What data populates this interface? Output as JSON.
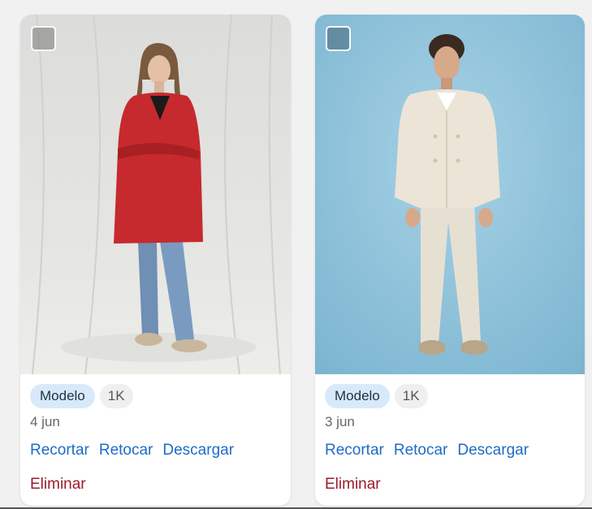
{
  "cards": [
    {
      "tag": "Modelo",
      "resolution": "1K",
      "date": "4 jun",
      "actions": {
        "crop": "Recortar",
        "retouch": "Retocar",
        "download": "Descargar"
      },
      "delete": "Eliminar",
      "image": {
        "subject": "woman-red-coat",
        "background": "#e2e2e0"
      }
    },
    {
      "tag": "Modelo",
      "resolution": "1K",
      "date": "3 jun",
      "actions": {
        "crop": "Recortar",
        "retouch": "Retocar",
        "download": "Descargar"
      },
      "delete": "Eliminar",
      "image": {
        "subject": "man-beige-peacoat",
        "background": "#8fc4dd"
      }
    }
  ],
  "colors": {
    "chip_model_bg": "#d8eaf9",
    "chip_res_bg": "#efefef",
    "action": "#1f6cc4",
    "delete": "#9c1c2a",
    "page_bg": "#f1f1f1"
  }
}
